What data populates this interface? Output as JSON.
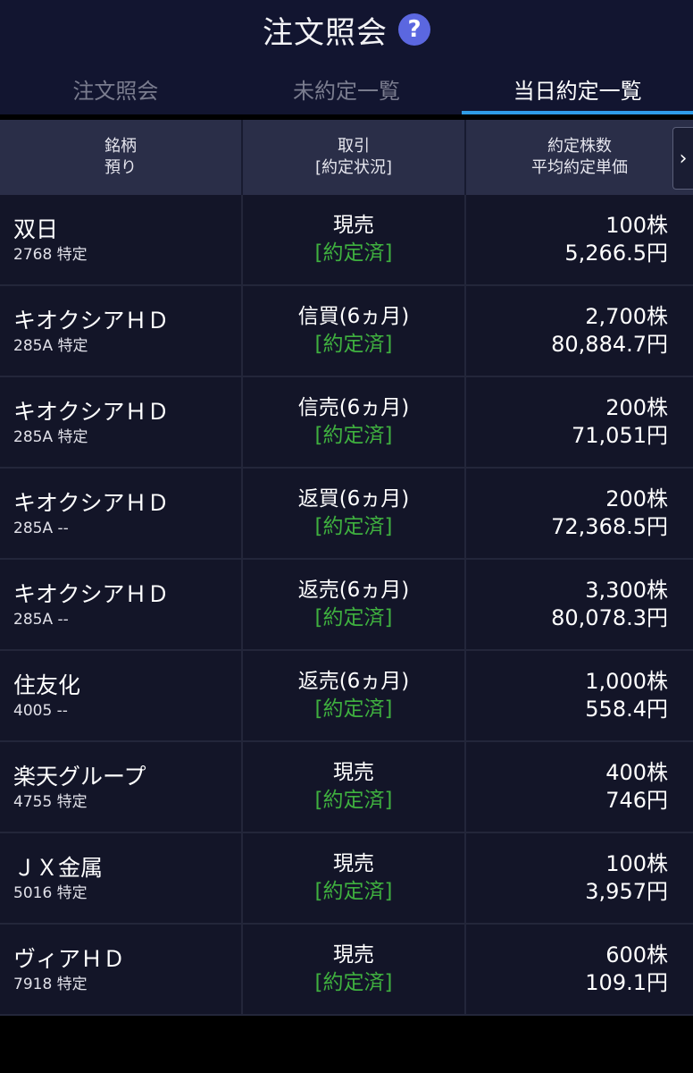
{
  "header": {
    "title": "注文照会",
    "help_icon": "question-circle-icon",
    "help_glyph": "?",
    "tabs": [
      {
        "label": "注文照会",
        "active": false
      },
      {
        "label": "未約定一覧",
        "active": false
      },
      {
        "label": "当日約定一覧",
        "active": true
      }
    ],
    "accent_color": "#2f9be6"
  },
  "table": {
    "headers": {
      "col1_line1": "銘柄",
      "col1_line2": "預り",
      "col2_line1": "取引",
      "col2_line2": "[約定状況]",
      "col3_line1": "約定株数",
      "col3_line2": "平均約定単価"
    },
    "scroll_arrow": "›",
    "status_color": "#3fb03f",
    "rows": [
      {
        "name": "双日",
        "code": "2768 特定",
        "trade": "現売",
        "status": "[約定済]",
        "qty": "100株",
        "price": "5,266.5円"
      },
      {
        "name": "キオクシアＨＤ",
        "code": "285A 特定",
        "trade": "信買(6ヵ月)",
        "status": "[約定済]",
        "qty": "2,700株",
        "price": "80,884.7円"
      },
      {
        "name": "キオクシアＨＤ",
        "code": "285A 特定",
        "trade": "信売(6ヵ月)",
        "status": "[約定済]",
        "qty": "200株",
        "price": "71,051円"
      },
      {
        "name": "キオクシアＨＤ",
        "code": "285A --",
        "trade": "返買(6ヵ月)",
        "status": "[約定済]",
        "qty": "200株",
        "price": "72,368.5円"
      },
      {
        "name": "キオクシアＨＤ",
        "code": "285A --",
        "trade": "返売(6ヵ月)",
        "status": "[約定済]",
        "qty": "3,300株",
        "price": "80,078.3円"
      },
      {
        "name": "住友化",
        "code": "4005 --",
        "trade": "返売(6ヵ月)",
        "status": "[約定済]",
        "qty": "1,000株",
        "price": "558.4円"
      },
      {
        "name": "楽天グループ",
        "code": "4755 特定",
        "trade": "現売",
        "status": "[約定済]",
        "qty": "400株",
        "price": "746円"
      },
      {
        "name": "ＪＸ金属",
        "code": "5016 特定",
        "trade": "現売",
        "status": "[約定済]",
        "qty": "100株",
        "price": "3,957円"
      },
      {
        "name": "ヴィアＨＤ",
        "code": "7918 特定",
        "trade": "現売",
        "status": "[約定済]",
        "qty": "600株",
        "price": "109.1円"
      }
    ]
  }
}
